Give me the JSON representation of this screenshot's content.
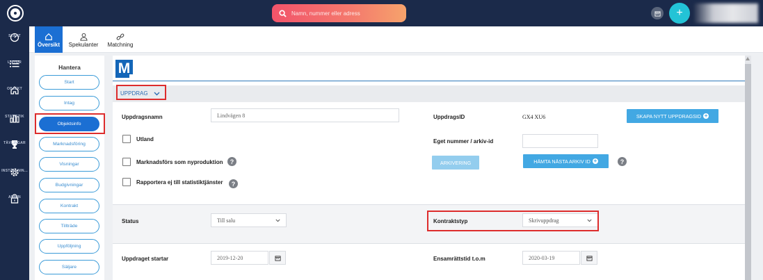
{
  "topbar": {
    "search_placeholder": "Namn, nummer eller adress",
    "add_label": "+"
  },
  "rail": {
    "items": [
      {
        "label": "START",
        "icon": "gauge-icon"
      },
      {
        "label": "LISTOR",
        "icon": "list-icon"
      },
      {
        "label": "OBJEKT",
        "icon": "house-icon"
      },
      {
        "label": "STATISTIK",
        "icon": "bar-chart-icon"
      },
      {
        "label": "TÄVLINGAR",
        "icon": "trophy-icon"
      },
      {
        "label": "INSTÄLLNIN...",
        "icon": "gear-icon"
      },
      {
        "label": "ADMIN",
        "icon": "lock-icon"
      }
    ]
  },
  "tabs": [
    {
      "label": "Översikt",
      "icon": "house-icon",
      "active": true
    },
    {
      "label": "Spekulanter",
      "icon": "people-icon",
      "active": false
    },
    {
      "label": "Matchning",
      "icon": "link-icon",
      "active": false
    }
  ],
  "leftpanel": {
    "title": "Hantera",
    "items": [
      "Start",
      "Intag",
      "Objektsinfo",
      "Marknadsföring",
      "Visningar",
      "Budgivningar",
      "Kontrakt",
      "Tillträde",
      "Uppföljning",
      "Säljare"
    ],
    "active_index": 2
  },
  "main": {
    "logo_letter": "M",
    "section_label": "UPPDRAG",
    "fields": {
      "uppdragsnamn_label": "Uppdragsnamn",
      "uppdragsnamn_value": "Lindvägen 8",
      "uppdragsid_label": "UppdragsID",
      "uppdragsid_value": "GX4 XU6",
      "skapa_btn": "SKAPA NYTT UPPDRAGSID",
      "utland_label": "Utland",
      "eget_nummer_label": "Eget nummer / arkiv-id",
      "eget_nummer_value": "",
      "nyproduktion_label": "Marknadsförs som nyproduktion",
      "arkivering_btn": "ARKIVERING",
      "hamta_btn": "HÄMTA NÄSTA ARKIV ID",
      "statistik_label": "Rapportera ej till statistiktjänster",
      "status_label": "Status",
      "status_value": "Till salu",
      "kontraktstyp_label": "Kontraktstyp",
      "kontraktstyp_value": "Skrivuppdrag",
      "startar_label": "Uppdraget startar",
      "startar_value": "2019-12-20",
      "ensamratt_label": "Ensamrättstid t.o.m",
      "ensamratt_value": "2020-03-19"
    }
  },
  "colors": {
    "navy": "#1b2a4a",
    "accent_blue": "#1b6fd3",
    "button_blue": "#42a8e3",
    "highlight_red": "#dd2c2c",
    "teal": "#23c3d6"
  }
}
